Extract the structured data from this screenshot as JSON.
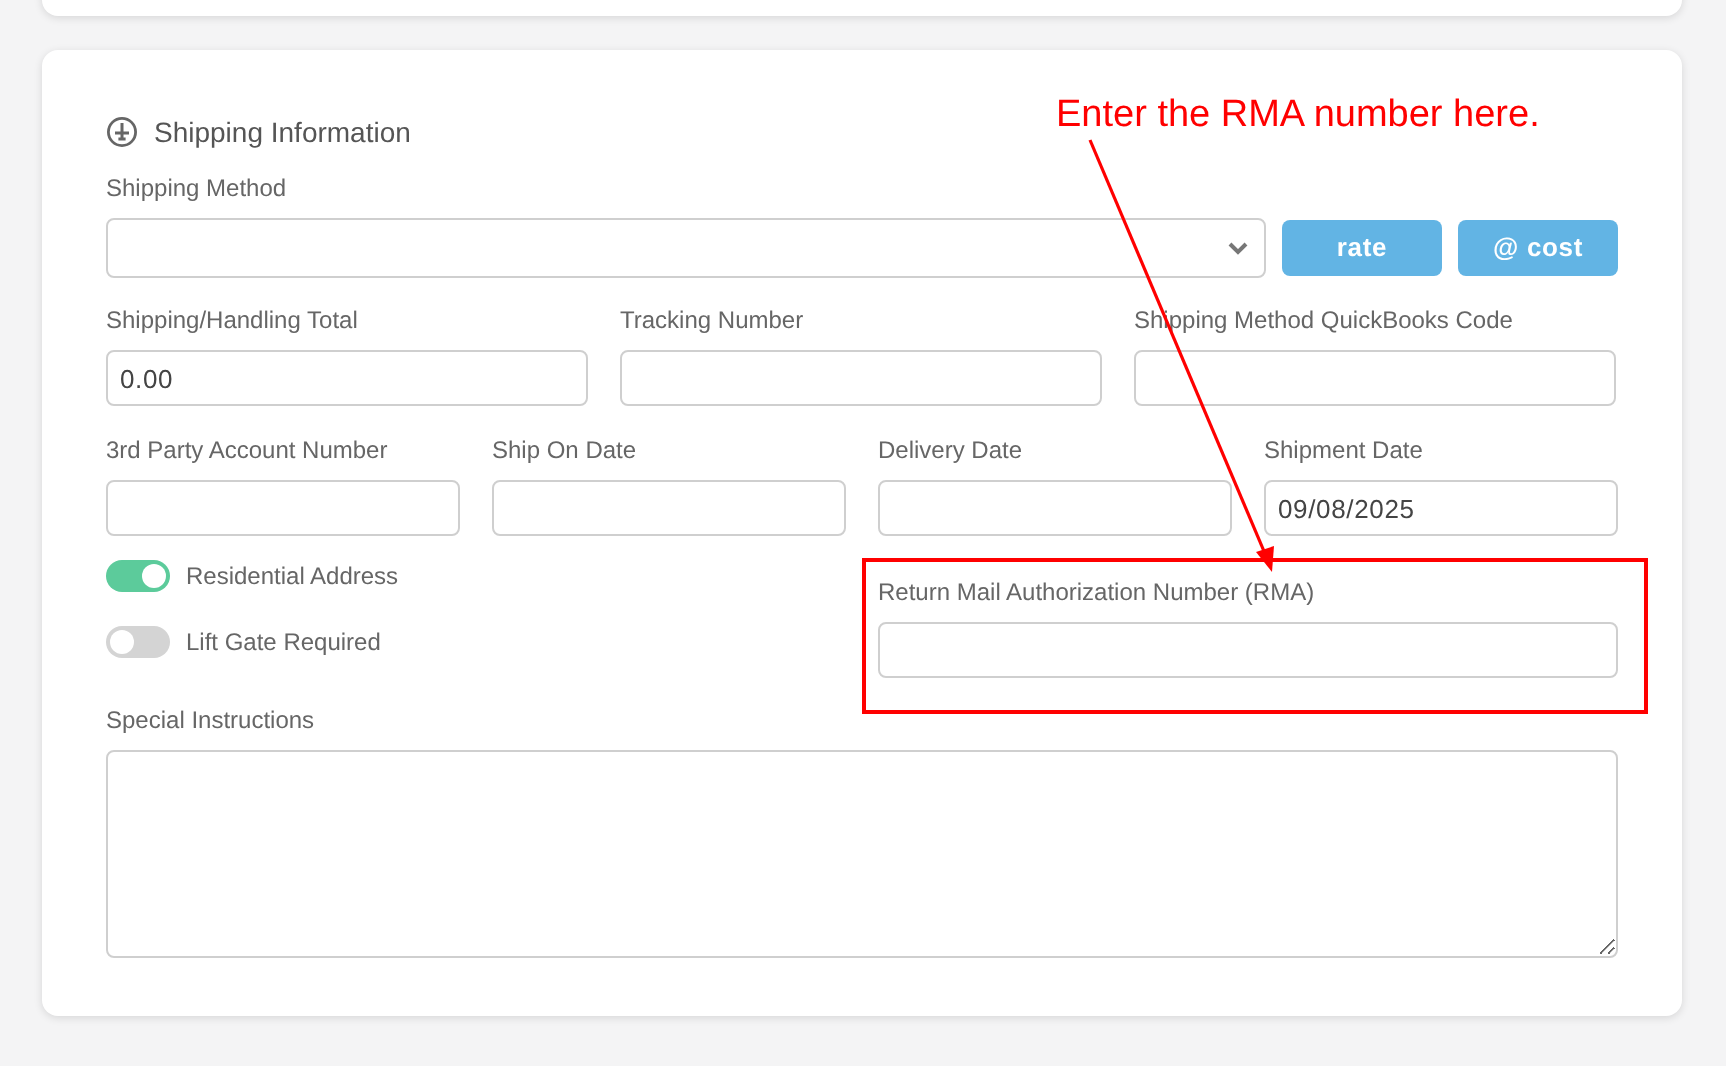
{
  "section": {
    "title": "Shipping Information"
  },
  "shipping_method": {
    "label": "Shipping Method"
  },
  "buttons": [
    {
      "label": "rate"
    },
    {
      "label": "@ cost"
    }
  ],
  "row_1": [
    {
      "label": "Shipping/Handling Total",
      "value": "0.00"
    },
    {
      "label": "Tracking Number"
    },
    {
      "label": "Shipping Method QuickBooks Code"
    }
  ],
  "row_2": [
    {
      "label": "3rd Party Account Number"
    },
    {
      "label": "Ship On Date"
    },
    {
      "label": "Delivery Date"
    },
    {
      "label": "Shipment Date",
      "value": "09/08/2025"
    }
  ],
  "toggles": [
    {
      "label": "Residential Address",
      "on": true
    },
    {
      "label": "Lift Gate Required",
      "on": false
    }
  ],
  "rma": {
    "label": "Return Mail Authorization Number (RMA)"
  },
  "special_instructions": {
    "label": "Special Instructions"
  },
  "annotation": {
    "text": "Enter the RMA number here."
  }
}
